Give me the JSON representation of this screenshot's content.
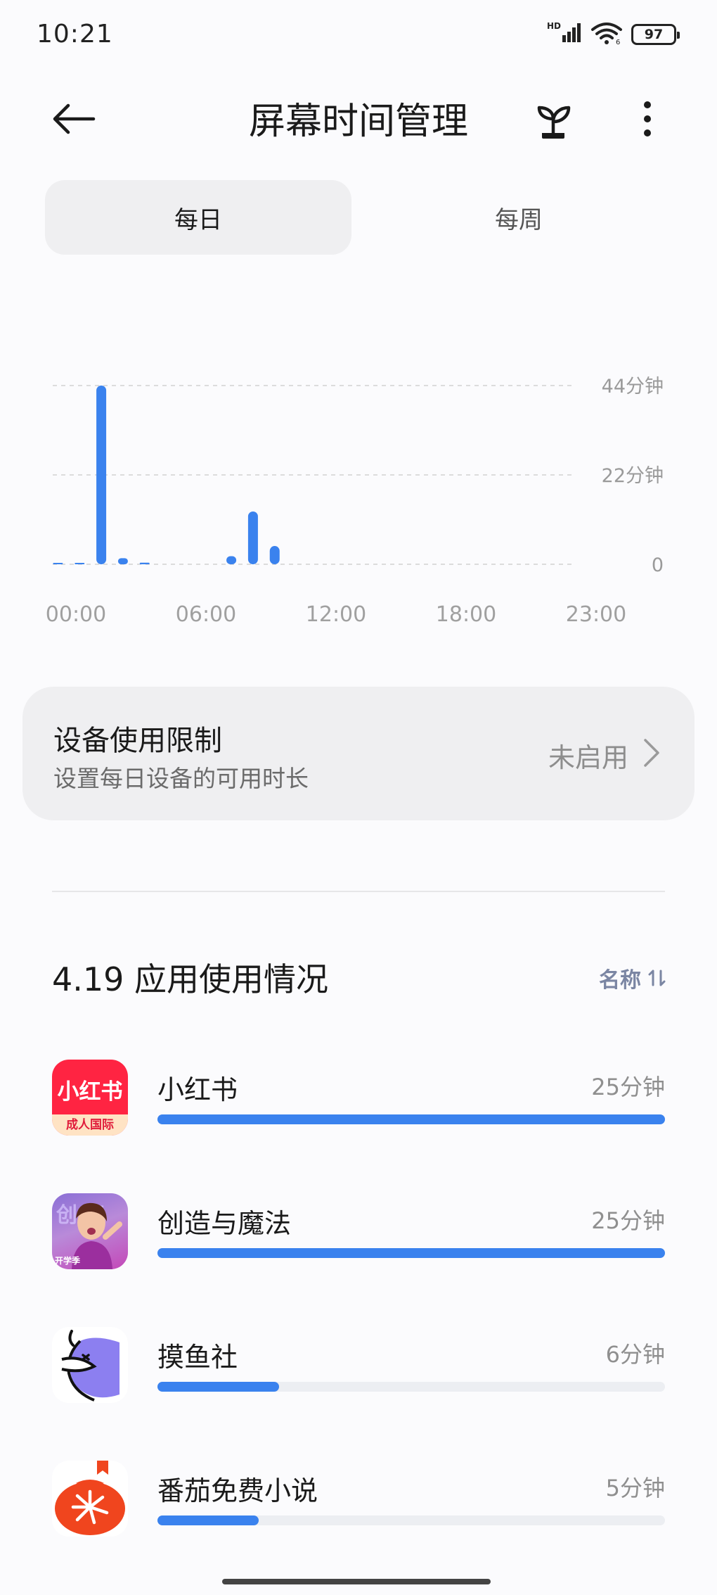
{
  "status_bar": {
    "time": "10:21",
    "network_label": "HD",
    "battery": "97",
    "icons": [
      "signal-icon",
      "wifi-icon",
      "battery-icon"
    ]
  },
  "header": {
    "title": "屏幕时间管理",
    "back_icon": "back-arrow-icon",
    "sprout_icon": "sprout-icon",
    "more_icon": "more-vertical-icon"
  },
  "tabs": [
    {
      "label": "每日",
      "selected": true
    },
    {
      "label": "每周",
      "selected": false
    }
  ],
  "chart_data": {
    "type": "bar",
    "x_ticks": [
      "00:00",
      "06:00",
      "12:00",
      "18:00",
      "23:00"
    ],
    "y_ticks": [
      "44分钟",
      "22分钟",
      "0"
    ],
    "ylim": [
      0,
      44
    ],
    "grid": true,
    "hours": [
      0,
      1,
      2,
      3,
      4,
      5,
      6,
      7,
      8,
      9,
      10,
      11,
      12,
      13,
      14,
      15,
      16,
      17,
      18,
      19,
      20,
      21,
      22,
      23
    ],
    "values": [
      0.2,
      0.2,
      44,
      1.5,
      0.4,
      0,
      0,
      0,
      2,
      13,
      4.5,
      0,
      0,
      0,
      0,
      0,
      0,
      0,
      0,
      0,
      0,
      0,
      0,
      0
    ],
    "bar_color": "#3a82ee"
  },
  "limit": {
    "title": "设备使用限制",
    "subtitle": "设置每日设备的可用时长",
    "status": "未启用"
  },
  "usage": {
    "title": "4.19 应用使用情况",
    "sort_label": "名称",
    "max_minutes": 25,
    "apps": [
      {
        "name": "小红书",
        "time": "25分钟",
        "minutes": 25,
        "icon": "xiaohongshu-icon",
        "icon_text": "小红书",
        "icon_subtext": "成人国际"
      },
      {
        "name": "创造与魔法",
        "time": "25分钟",
        "minutes": 25,
        "icon": "chuangzao-icon",
        "icon_text": "创魔",
        "icon_subtext": "开学季"
      },
      {
        "name": "摸鱼社",
        "time": "6分钟",
        "minutes": 6,
        "icon": "fish-icon"
      },
      {
        "name": "番茄免费小说",
        "time": "5分钟",
        "minutes": 5,
        "icon": "tomato-icon"
      }
    ]
  },
  "colors": {
    "accent": "#3a82ee",
    "track": "#eceef2",
    "card": "#efeff1"
  }
}
